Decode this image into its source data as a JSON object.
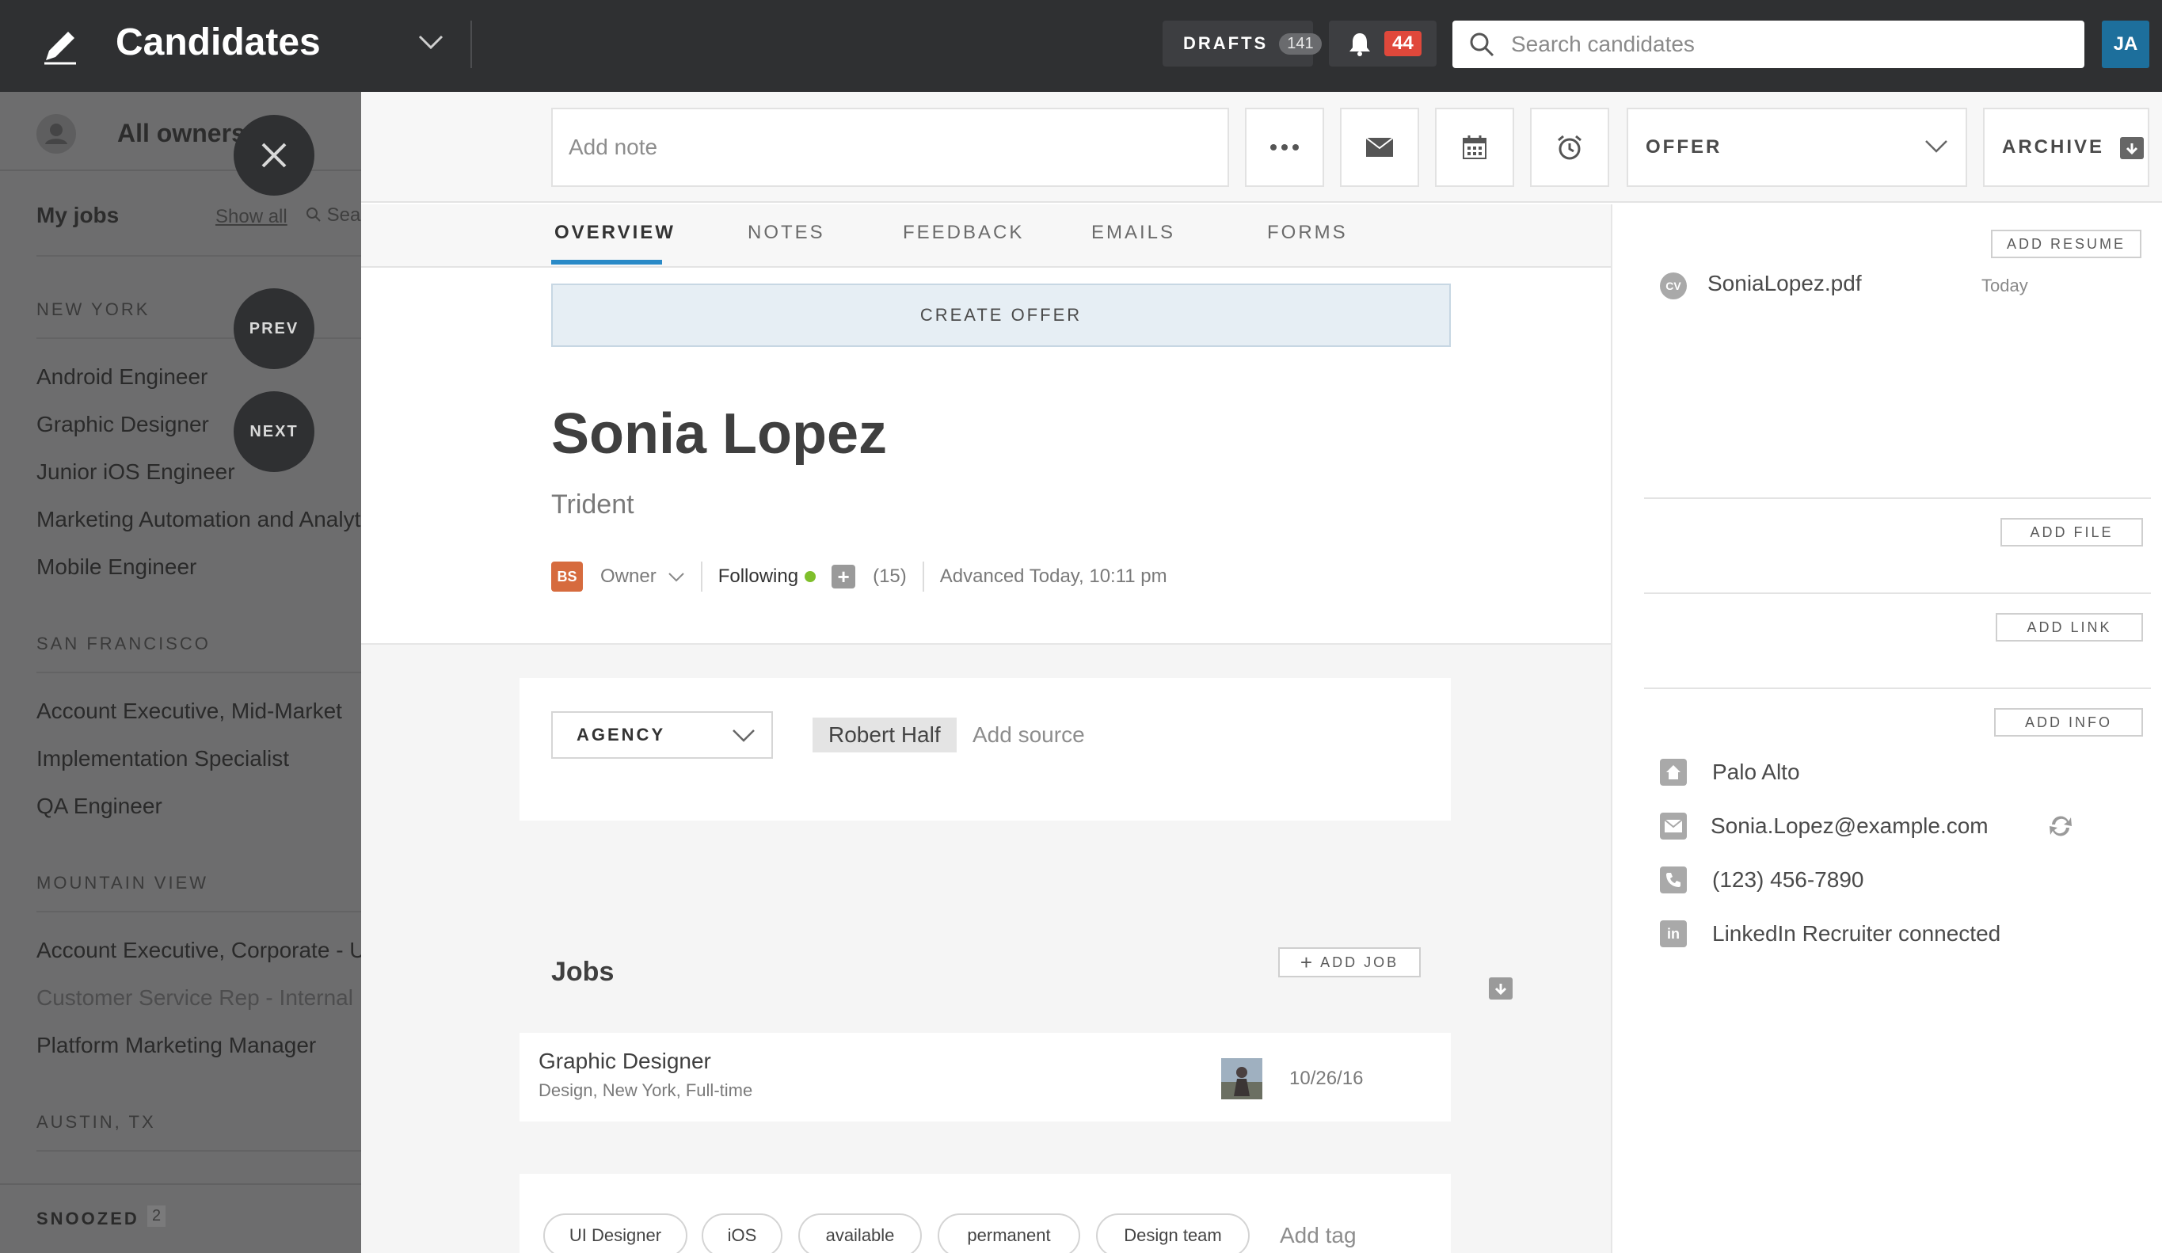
{
  "topbar": {
    "title": "Candidates",
    "drafts_label": "DRAFTS",
    "drafts_count": "141",
    "notifications_count": "44",
    "search_placeholder": "Search candidates",
    "user_initials": "JA",
    "colors": {
      "bar": "#2f3032",
      "badge": "#e0483b",
      "avatar": "#1d6f9c"
    }
  },
  "sidebar": {
    "owners_label": "All owners",
    "my_jobs_label": "My jobs",
    "show_all_label": "Show all",
    "search_label": "Sea",
    "groups": [
      {
        "heading": "NEW YORK",
        "items": [
          "Android Engineer",
          "Graphic Designer",
          "Junior iOS Engineer",
          "Marketing Automation and Analyt...",
          "Mobile Engineer"
        ]
      },
      {
        "heading": "SAN FRANCISCO",
        "items": [
          "Account Executive, Mid-Market",
          "Implementation Specialist",
          "QA Engineer"
        ]
      },
      {
        "heading": "MOUNTAIN VIEW",
        "items": [
          "Account Executive, Corporate - U...",
          "Customer Service Rep - Internal ...",
          "Platform Marketing Manager"
        ]
      },
      {
        "heading": "AUSTIN, TX",
        "items": []
      }
    ],
    "snoozed_label": "SNOOZED",
    "snoozed_count": "2"
  },
  "overlay": {
    "prev_label": "PREV",
    "next_label": "NEXT"
  },
  "actions": {
    "note_placeholder": "Add note",
    "stage_label": "OFFER",
    "archive_label": "ARCHIVE"
  },
  "tabs": [
    {
      "label": "OVERVIEW",
      "active": true
    },
    {
      "label": "NOTES",
      "active": false
    },
    {
      "label": "FEEDBACK",
      "active": false
    },
    {
      "label": "EMAILS",
      "active": false
    },
    {
      "label": "FORMS",
      "active": false
    }
  ],
  "candidate": {
    "create_offer_label": "CREATE OFFER",
    "name": "Sonia Lopez",
    "company": "Trident",
    "owner_initials": "BS",
    "owner_label": "Owner",
    "following_label": "Following",
    "followers_count": "(15)",
    "advanced_text": "Advanced Today, 10:11 pm"
  },
  "source": {
    "type_label": "AGENCY",
    "value": "Robert Half",
    "add_source_label": "Add source"
  },
  "jobs": {
    "title": "Jobs",
    "add_job_label": "ADD JOB",
    "items": [
      {
        "title": "Graphic Designer",
        "subtitle": "Design, New York, Full-time",
        "date": "10/26/16"
      }
    ]
  },
  "tags": {
    "items": [
      "UI Designer",
      "iOS",
      "available",
      "permanent",
      "Design team"
    ],
    "add_tag_label": "Add tag"
  },
  "right": {
    "add_resume_label": "ADD RESUME",
    "resume": {
      "icon_label": "CV",
      "name": "SoniaLopez.pdf",
      "date": "Today"
    },
    "add_file_label": "ADD FILE",
    "add_link_label": "ADD LINK",
    "add_info_label": "ADD INFO",
    "info": {
      "location": "Palo Alto",
      "email": "Sonia.Lopez@example.com",
      "phone": "(123) 456-7890",
      "linkedin": "LinkedIn Recruiter connected"
    }
  }
}
